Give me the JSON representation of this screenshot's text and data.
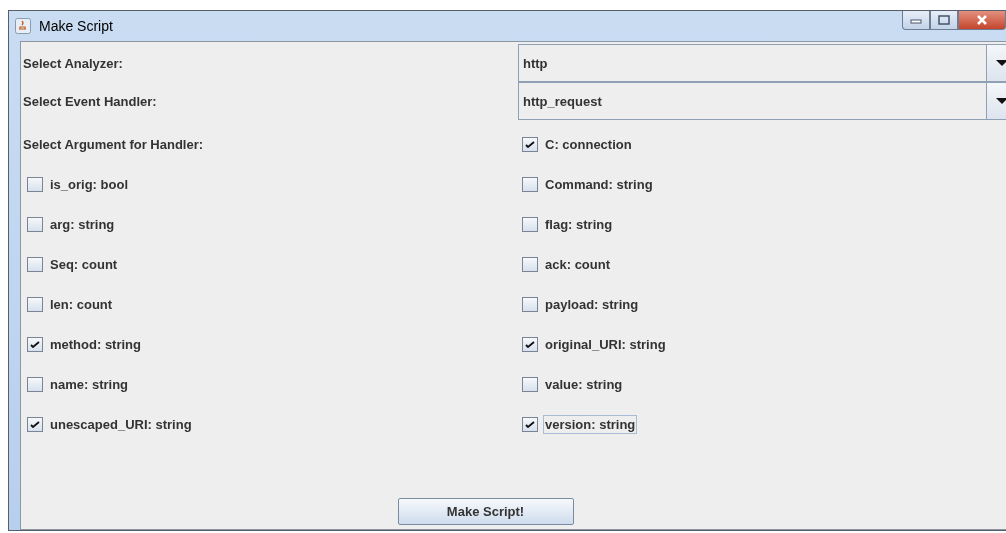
{
  "window": {
    "title": "Make Script"
  },
  "selectors": [
    {
      "label": "Select Analyzer:",
      "value": "http"
    },
    {
      "label": "Select Event Handler:",
      "value": "http_request"
    }
  ],
  "arguments_label": "Select Argument for Handler:",
  "arguments": [
    {
      "label": "C: connection",
      "checked": true,
      "focused": false
    },
    {
      "label": "is_orig: bool",
      "checked": false,
      "focused": false
    },
    {
      "label": "Command: string",
      "checked": false,
      "focused": false
    },
    {
      "label": "arg: string",
      "checked": false,
      "focused": false
    },
    {
      "label": "flag: string",
      "checked": false,
      "focused": false
    },
    {
      "label": "Seq: count",
      "checked": false,
      "focused": false
    },
    {
      "label": "ack: count",
      "checked": false,
      "focused": false
    },
    {
      "label": "len: count",
      "checked": false,
      "focused": false
    },
    {
      "label": "payload: string",
      "checked": false,
      "focused": false
    },
    {
      "label": "method: string",
      "checked": true,
      "focused": false
    },
    {
      "label": "original_URI: string",
      "checked": true,
      "focused": false
    },
    {
      "label": "name: string",
      "checked": false,
      "focused": false
    },
    {
      "label": "value: string",
      "checked": false,
      "focused": false
    },
    {
      "label": "unescaped_URI: string",
      "checked": true,
      "focused": false
    },
    {
      "label": "version: string",
      "checked": true,
      "focused": true
    }
  ],
  "button": "Make Script!"
}
